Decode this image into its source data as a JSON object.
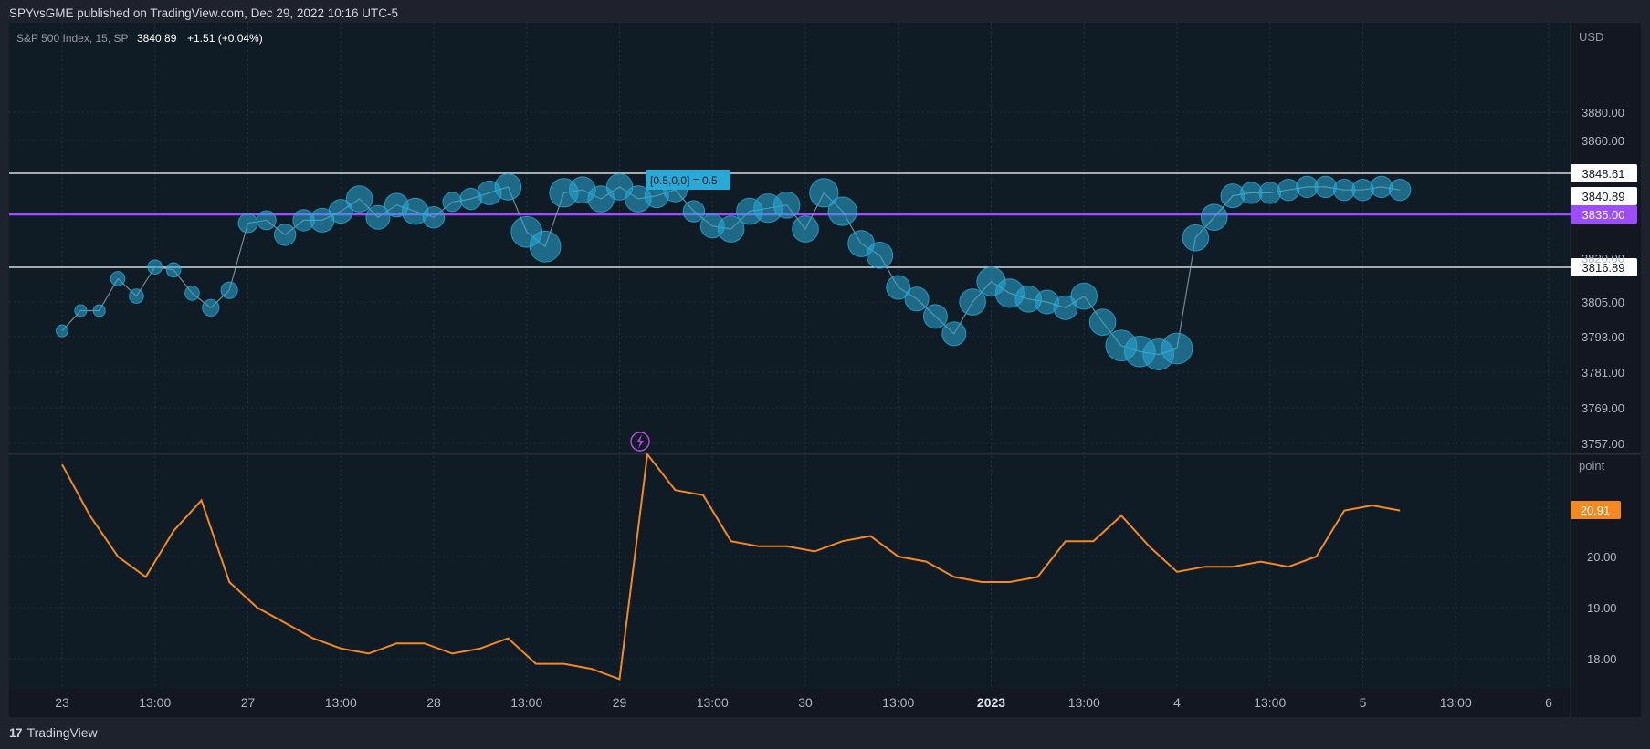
{
  "header": "SPYvsGME published on TradingView.com, Dec 29, 2022 10:16 UTC-5",
  "footer": {
    "logo_mark": "17",
    "brand": "TradingView"
  },
  "legend": {
    "symbol": "S&P 500 Index, 15, SP",
    "price": "3840.89",
    "change": "+1.51 (+0.04%)"
  },
  "colors": {
    "background": "#1e222d",
    "pane": "#0f1c26",
    "bubble": "#29a9d6",
    "orange": "#f5891f",
    "purple": "#9c4dff"
  },
  "chart_data": [
    {
      "type": "scatter",
      "title": "S&P 500 Index, 15, SP",
      "ylabel": "USD",
      "x_ticks": [
        "23",
        "13:00",
        "27",
        "13:00",
        "28",
        "13:00",
        "29",
        "13:00",
        "30",
        "13:00",
        "2023",
        "13:00",
        "4",
        "13:00",
        "5",
        "13:00",
        "6"
      ],
      "y_ticks": [
        3880.0,
        3860.0,
        3805.0,
        3793.0,
        3781.0,
        3769.0,
        3757.0
      ],
      "y_tick_labels": [
        "3880.00",
        "3860.00",
        "3805.00",
        "3793.00",
        "3781.00",
        "3769.00",
        "3757.00"
      ],
      "hidden_tick_label": "3820.00",
      "price_levels": [
        {
          "label": "3848.61",
          "value": 3848.61,
          "style": "white"
        },
        {
          "label": "3840.89",
          "value": 3840.89,
          "style": "white"
        },
        {
          "label": "3835.00",
          "value": 3835.0,
          "style": "purple"
        },
        {
          "label": "3816.89",
          "value": 3816.89,
          "style": "white"
        }
      ],
      "annotation": "[0.5,0,0] = 0.5",
      "x": [
        0,
        0.1,
        0.2,
        0.3,
        0.4,
        0.5,
        0.6,
        0.7,
        0.8,
        0.9,
        1.0,
        1.1,
        1.2,
        1.3,
        1.4,
        1.5,
        1.6,
        1.7,
        1.8,
        1.9,
        2.0,
        2.1,
        2.2,
        2.3,
        2.4,
        2.5,
        2.6,
        2.7,
        2.8,
        2.9,
        3.0,
        3.1,
        3.2,
        3.3,
        3.4,
        3.5,
        3.6,
        3.7,
        3.8,
        3.9,
        4.0,
        4.1,
        4.2,
        4.3,
        4.4,
        4.5,
        4.6,
        4.7,
        4.8,
        4.9,
        5.0,
        5.1,
        5.2,
        5.3,
        5.4,
        5.5,
        5.6,
        5.7,
        5.8,
        5.9,
        6.0,
        6.1,
        6.2,
        6.3,
        6.4,
        6.5,
        6.6,
        6.7,
        6.8,
        6.9,
        7.0,
        7.1,
        7.2
      ],
      "y": [
        3795,
        3802,
        3802,
        3813,
        3807,
        3817,
        3816,
        3808,
        3803,
        3809,
        3832,
        3833,
        3828,
        3833,
        3833,
        3836,
        3840,
        3834,
        3838,
        3836,
        3834,
        3839,
        3840,
        3842,
        3844,
        3829,
        3824,
        3842,
        3843,
        3840,
        3844,
        3840,
        3841,
        3843,
        3836,
        3831,
        3830,
        3836,
        3837,
        3838,
        3830,
        3842,
        3836,
        3825,
        3821,
        3810,
        3806,
        3800,
        3794,
        3805,
        3812,
        3808,
        3806,
        3805,
        3803,
        3807,
        3798,
        3790,
        3788,
        3787,
        3789,
        3827,
        3834,
        3841,
        3842,
        3842,
        3843,
        3844,
        3844,
        3843,
        3843,
        3844,
        3843
      ],
      "bubble_size": [
        10,
        10,
        10,
        12,
        12,
        12,
        12,
        12,
        14,
        14,
        16,
        16,
        18,
        18,
        20,
        20,
        22,
        20,
        20,
        22,
        18,
        16,
        18,
        20,
        22,
        26,
        26,
        24,
        22,
        22,
        22,
        22,
        20,
        20,
        18,
        20,
        22,
        22,
        24,
        22,
        22,
        24,
        24,
        22,
        22,
        20,
        20,
        20,
        20,
        22,
        24,
        24,
        22,
        20,
        20,
        22,
        22,
        26,
        26,
        26,
        26,
        22,
        22,
        20,
        18,
        18,
        18,
        18,
        18,
        18,
        18,
        18,
        18
      ]
    },
    {
      "type": "line",
      "ylabel": "point",
      "y_ticks": [
        20.0,
        19.0,
        18.0
      ],
      "y_tick_labels": [
        "20.00",
        "19.00",
        "18.00"
      ],
      "last_value_label": "20.91",
      "last_value": 20.91,
      "x": [
        0,
        0.15,
        0.3,
        0.45,
        0.6,
        0.75,
        0.9,
        1.05,
        1.2,
        1.35,
        1.5,
        1.65,
        1.8,
        1.95,
        2.1,
        2.25,
        2.4,
        2.55,
        2.7,
        2.85,
        3.0,
        3.15,
        3.3,
        3.45,
        3.6,
        3.75,
        3.9,
        4.05,
        4.2,
        4.35,
        4.5,
        4.65,
        4.8,
        4.95,
        5.1,
        5.25,
        5.4,
        5.55,
        5.7,
        5.85,
        6.0,
        6.15,
        6.3,
        6.45,
        6.6,
        6.75,
        6.9,
        7.05,
        7.2
      ],
      "y": [
        21.8,
        20.8,
        20.0,
        19.6,
        20.5,
        21.1,
        19.5,
        19.0,
        18.7,
        18.4,
        18.2,
        18.1,
        18.3,
        18.3,
        18.1,
        18.2,
        18.4,
        17.9,
        17.9,
        17.8,
        17.6,
        22.0,
        21.3,
        21.2,
        20.3,
        20.2,
        20.2,
        20.1,
        20.3,
        20.4,
        20.0,
        19.9,
        19.6,
        19.5,
        19.5,
        19.6,
        20.3,
        20.3,
        20.8,
        20.2,
        19.7,
        19.8,
        19.8,
        19.9,
        19.8,
        20.0,
        20.9,
        21.0,
        20.9
      ]
    }
  ]
}
